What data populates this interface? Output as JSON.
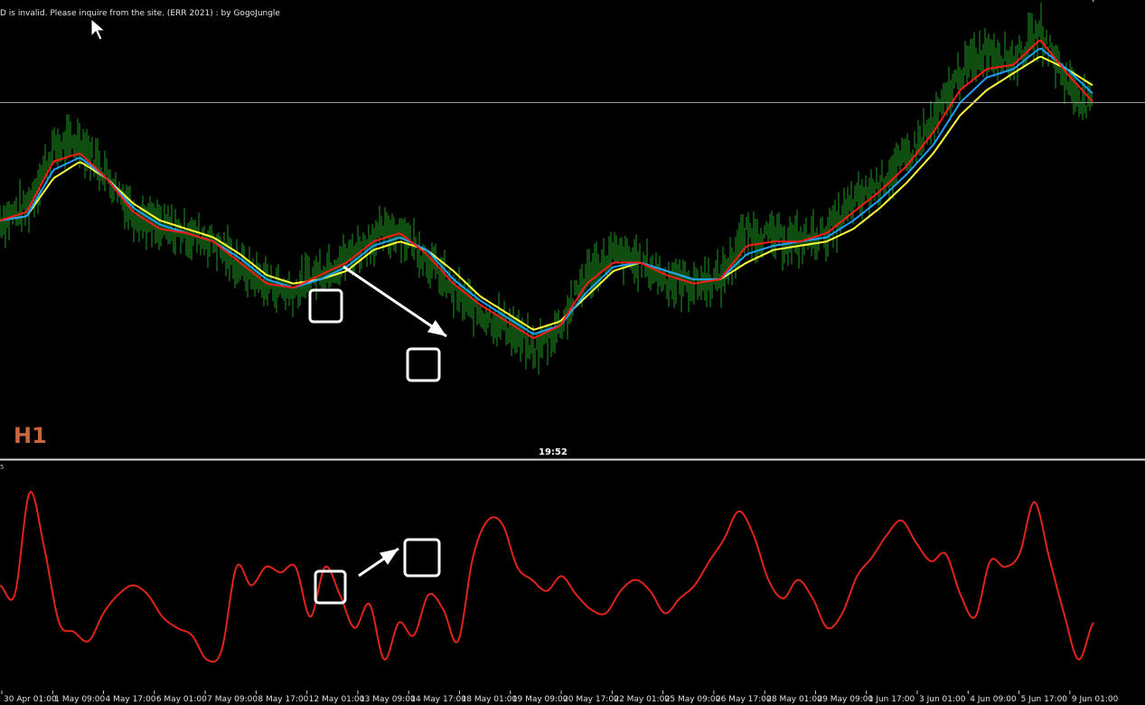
{
  "window": {
    "error_message": "D is invalid. Please inquire from the site. (ERR 2021) : by GogoJungle",
    "timeframe_label": "H1",
    "time_label": "19:52",
    "subwindow_value_label": "5"
  },
  "colors": {
    "background": "#000000",
    "price_bars": "#1f9a1f",
    "ma_fast": "#ff1a1a",
    "ma_mid": "#1ea0ff",
    "ma_slow": "#ffff3a",
    "oscillator": "#e0241a",
    "box_markers": "#ffffff",
    "timeframe_label": "#c8663e"
  },
  "chart_data": [
    {
      "type": "line",
      "panel": "main",
      "description_free": true,
      "x_axis_tick_labels": [
        "30 Apr 01:00",
        "1 May 09:00",
        "4 May 17:00",
        "6 May 01:00",
        "7 May 09:00",
        "8 May 17:00",
        "12 May 01:00",
        "13 May 09:00",
        "14 May 17:00",
        "18 May 01:00",
        "19 May 09:00",
        "20 May 17:00",
        "22 May 01:00",
        "25 May 09:00",
        "26 May 17:00",
        "28 May 01:00",
        "29 May 09:00",
        "1 Jun 17:00",
        "3 Jun 01:00",
        "4 Jun 09:00",
        "5 Jun 17:00",
        "9 Jun 01:00"
      ],
      "series": [
        {
          "key": "price",
          "values": [
            0.55,
            0.58,
            0.72,
            0.74,
            0.66,
            0.57,
            0.53,
            0.52,
            0.5,
            0.44,
            0.4,
            0.38,
            0.43,
            0.46,
            0.51,
            0.53,
            0.46,
            0.38,
            0.33,
            0.3,
            0.24,
            0.3,
            0.42,
            0.47,
            0.45,
            0.41,
            0.4,
            0.41,
            0.52,
            0.51,
            0.5,
            0.52,
            0.59,
            0.64,
            0.7,
            0.78,
            0.9,
            0.96,
            0.93,
            1.0,
            0.88,
            0.81
          ]
        },
        {
          "key": "ma_fast",
          "values": [
            0.55,
            0.57,
            0.69,
            0.71,
            0.65,
            0.57,
            0.53,
            0.52,
            0.5,
            0.45,
            0.4,
            0.39,
            0.42,
            0.45,
            0.5,
            0.52,
            0.47,
            0.4,
            0.35,
            0.31,
            0.27,
            0.3,
            0.4,
            0.45,
            0.45,
            0.42,
            0.4,
            0.41,
            0.49,
            0.5,
            0.5,
            0.52,
            0.57,
            0.62,
            0.68,
            0.76,
            0.86,
            0.91,
            0.92,
            0.98,
            0.9,
            0.83
          ]
        },
        {
          "key": "ma_mid",
          "values": [
            0.55,
            0.56,
            0.67,
            0.7,
            0.65,
            0.58,
            0.54,
            0.52,
            0.5,
            0.46,
            0.41,
            0.39,
            0.41,
            0.44,
            0.49,
            0.51,
            0.48,
            0.41,
            0.36,
            0.32,
            0.28,
            0.3,
            0.38,
            0.44,
            0.45,
            0.43,
            0.41,
            0.41,
            0.47,
            0.49,
            0.5,
            0.51,
            0.55,
            0.6,
            0.66,
            0.73,
            0.83,
            0.89,
            0.91,
            0.96,
            0.91,
            0.85
          ]
        },
        {
          "key": "ma_slow",
          "values": [
            0.55,
            0.56,
            0.65,
            0.69,
            0.65,
            0.59,
            0.55,
            0.53,
            0.51,
            0.47,
            0.42,
            0.4,
            0.41,
            0.43,
            0.48,
            0.5,
            0.48,
            0.43,
            0.37,
            0.33,
            0.29,
            0.31,
            0.37,
            0.43,
            0.45,
            0.43,
            0.41,
            0.41,
            0.45,
            0.48,
            0.49,
            0.5,
            0.53,
            0.58,
            0.64,
            0.71,
            0.8,
            0.86,
            0.9,
            0.94,
            0.91,
            0.87
          ]
        }
      ],
      "horizontal_line": 0.83,
      "markers": [
        "box",
        "box",
        "arrow-down-right"
      ]
    },
    {
      "type": "line",
      "panel": "oscillator",
      "series": [
        {
          "key": "oscillator",
          "values": [
            0.45,
            0.4,
            0.95,
            0.65,
            0.25,
            0.2,
            0.15,
            0.3,
            0.4,
            0.45,
            0.4,
            0.28,
            0.22,
            0.18,
            0.05,
            0.1,
            0.55,
            0.45,
            0.55,
            0.52,
            0.55,
            0.28,
            0.55,
            0.4,
            0.22,
            0.35,
            0.05,
            0.25,
            0.18,
            0.4,
            0.32,
            0.15,
            0.6,
            0.8,
            0.78,
            0.55,
            0.48,
            0.42,
            0.5,
            0.4,
            0.32,
            0.3,
            0.42,
            0.48,
            0.42,
            0.3,
            0.38,
            0.45,
            0.58,
            0.7,
            0.85,
            0.72,
            0.48,
            0.38,
            0.48,
            0.38,
            0.22,
            0.3,
            0.5,
            0.6,
            0.72,
            0.8,
            0.68,
            0.58,
            0.62,
            0.4,
            0.28,
            0.58,
            0.55,
            0.62,
            0.9,
            0.6,
            0.3,
            0.05,
            0.25
          ]
        }
      ],
      "markers": [
        "box",
        "box",
        "arrow-up-right"
      ]
    }
  ]
}
